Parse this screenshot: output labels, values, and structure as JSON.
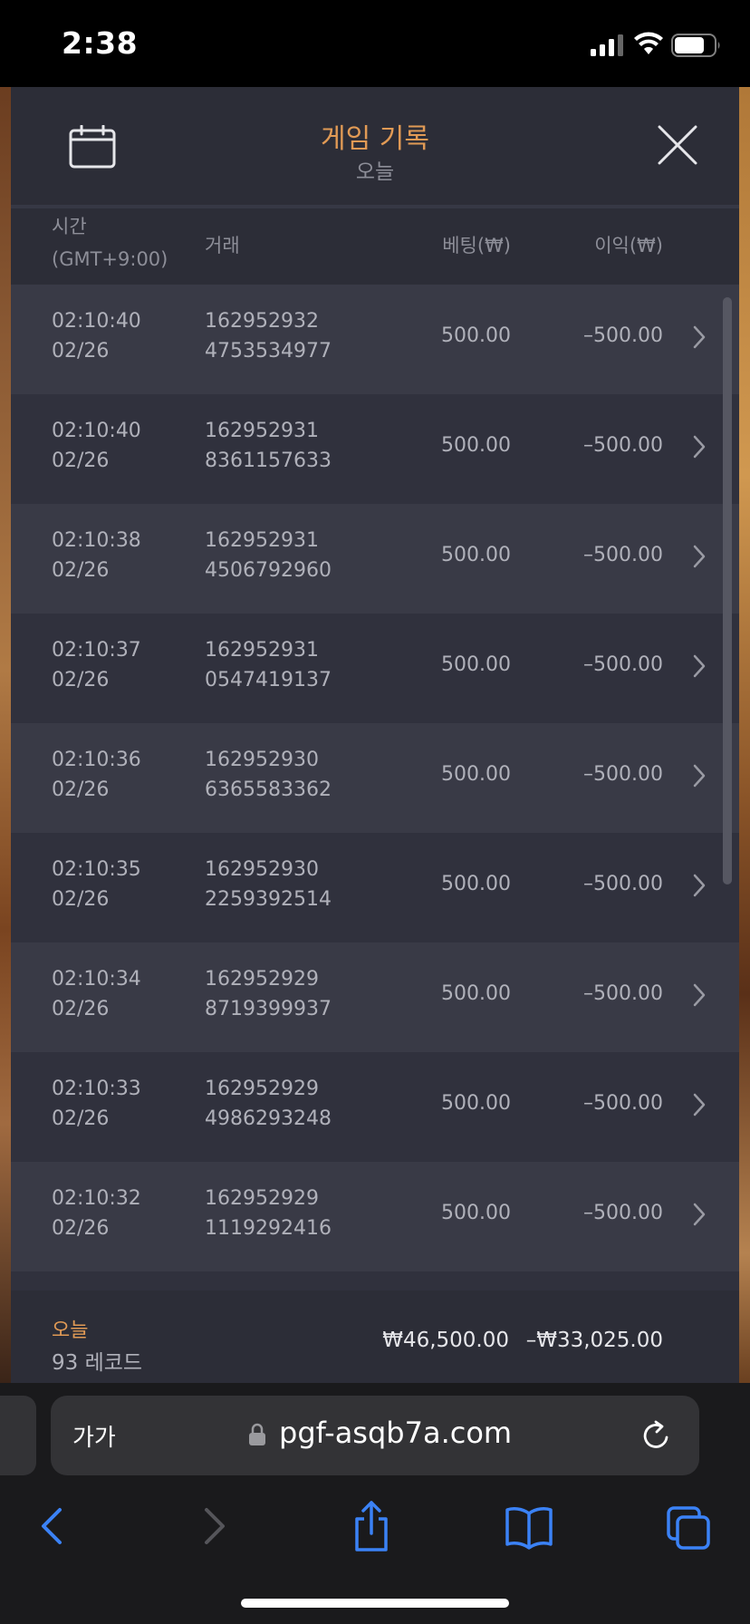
{
  "status_bar": {
    "time": "2:38"
  },
  "panel": {
    "title": "게임 기록",
    "subtitle": "오늘",
    "columns": {
      "time_line1": "시간",
      "time_line2": "(GMT+9:00)",
      "trade": "거래",
      "bet": "베팅(₩)",
      "profit": "이익(₩)"
    },
    "rows": [
      {
        "time": "02:10:40",
        "date": "02/26",
        "trade_1": "162952932",
        "trade_2": "4753534977",
        "bet": "500.00",
        "profit": "–500.00"
      },
      {
        "time": "02:10:40",
        "date": "02/26",
        "trade_1": "162952931",
        "trade_2": "8361157633",
        "bet": "500.00",
        "profit": "–500.00"
      },
      {
        "time": "02:10:38",
        "date": "02/26",
        "trade_1": "162952931",
        "trade_2": "4506792960",
        "bet": "500.00",
        "profit": "–500.00"
      },
      {
        "time": "02:10:37",
        "date": "02/26",
        "trade_1": "162952931",
        "trade_2": "0547419137",
        "bet": "500.00",
        "profit": "–500.00"
      },
      {
        "time": "02:10:36",
        "date": "02/26",
        "trade_1": "162952930",
        "trade_2": "6365583362",
        "bet": "500.00",
        "profit": "–500.00"
      },
      {
        "time": "02:10:35",
        "date": "02/26",
        "trade_1": "162952930",
        "trade_2": "2259392514",
        "bet": "500.00",
        "profit": "–500.00"
      },
      {
        "time": "02:10:34",
        "date": "02/26",
        "trade_1": "162952929",
        "trade_2": "8719399937",
        "bet": "500.00",
        "profit": "–500.00"
      },
      {
        "time": "02:10:33",
        "date": "02/26",
        "trade_1": "162952929",
        "trade_2": "4986293248",
        "bet": "500.00",
        "profit": "–500.00"
      },
      {
        "time": "02:10:32",
        "date": "02/26",
        "trade_1": "162952929",
        "trade_2": "1119292416",
        "bet": "500.00",
        "profit": "–500.00"
      }
    ],
    "footer": {
      "label": "오늘",
      "count": "93 레코드",
      "total_bet": "₩46,500.00",
      "total_profit": "–₩33,025.00"
    }
  },
  "safari": {
    "aa_label": "가가",
    "url": "pgf-asqb7a.com"
  },
  "icons": {
    "calendar": "calendar-icon",
    "close": "close-icon",
    "chevron": "chevron-right-icon",
    "lock": "lock-icon",
    "reload": "reload-icon",
    "back": "back-icon",
    "forward": "forward-icon",
    "share": "share-icon",
    "bookmarks": "bookmarks-icon",
    "tabs": "tabs-icon"
  },
  "colors": {
    "accent": "#e19a55",
    "panel_bg": "#2c2d37",
    "row_light": "#393a46",
    "row_dark": "#30313d",
    "safari_blue": "#3b82f6"
  }
}
